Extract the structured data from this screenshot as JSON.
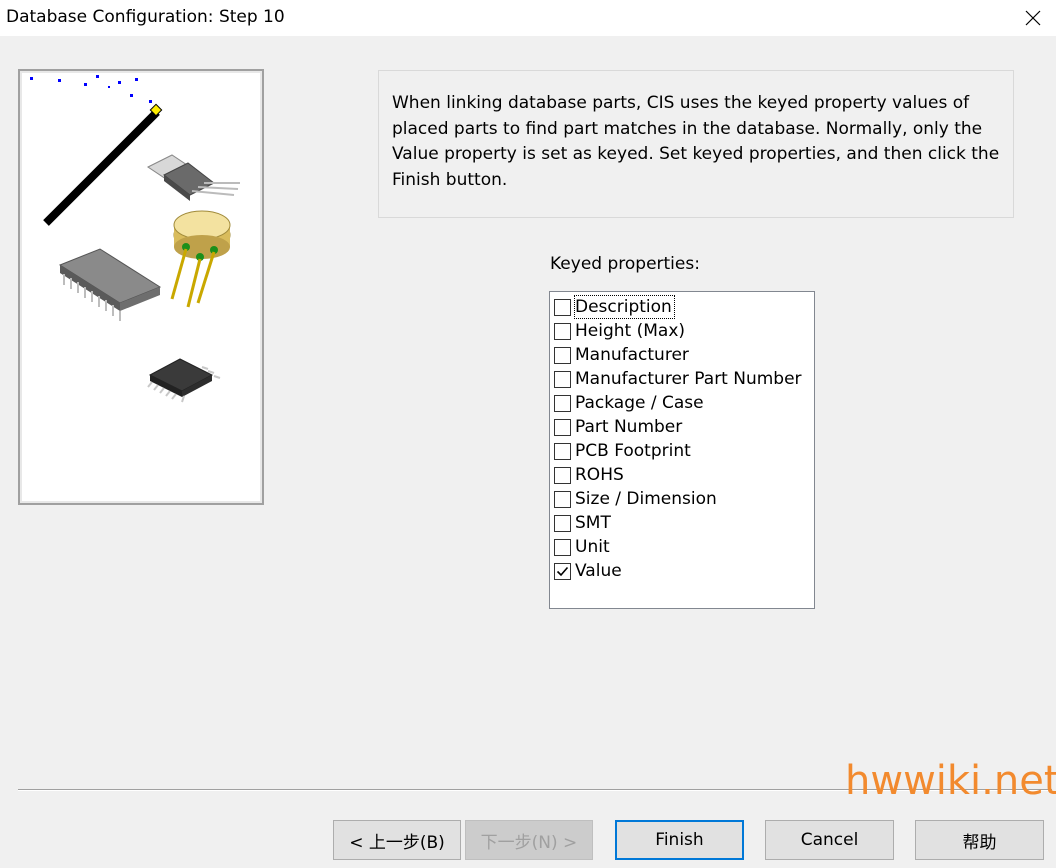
{
  "window": {
    "title": "Database Configuration: Step 10",
    "close_icon": "close-icon"
  },
  "info": {
    "text": "When linking database parts, CIS uses the keyed property values of placed parts to find part matches in the database. Normally, only the Value property is set as keyed. Set keyed properties, and then click the Finish button."
  },
  "keyed": {
    "label": "Keyed properties:",
    "items": [
      {
        "label": "Description",
        "checked": false
      },
      {
        "label": "Height (Max)",
        "checked": false
      },
      {
        "label": "Manufacturer",
        "checked": false
      },
      {
        "label": "Manufacturer Part Number",
        "checked": false
      },
      {
        "label": "Package / Case",
        "checked": false
      },
      {
        "label": "Part Number",
        "checked": false
      },
      {
        "label": "PCB Footprint",
        "checked": false
      },
      {
        "label": "ROHS",
        "checked": false
      },
      {
        "label": "Size / Dimension",
        "checked": false
      },
      {
        "label": "SMT",
        "checked": false
      },
      {
        "label": "Unit",
        "checked": false
      },
      {
        "label": "Value",
        "checked": true
      }
    ]
  },
  "buttons": {
    "back": "< 上一步(B)",
    "next": "下一步(N) >",
    "finish": "Finish",
    "cancel": "Cancel",
    "help": "帮助"
  },
  "watermark": "hwwiki.net",
  "colors": {
    "watermark": "#f28a2e",
    "focus_border": "#0078d7",
    "wand_tip": "#ffee00",
    "sparkle": "#0000ff"
  }
}
